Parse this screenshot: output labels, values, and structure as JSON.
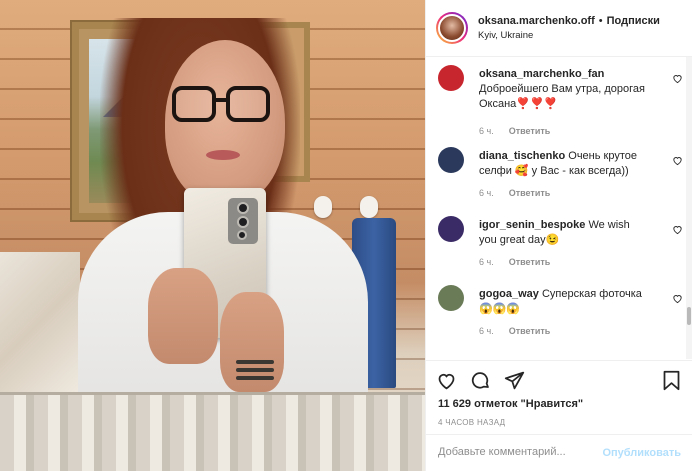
{
  "post": {
    "username": "oksana.marchenko.off",
    "separator": "•",
    "follow_label": "Подписки",
    "location": "Kyiv, Ukraine"
  },
  "comments": [
    {
      "username": "oksana_marchenko_fan",
      "text": "Доброейшего Вам утра, дорогая Оксана❣️❣️❣️",
      "time": "6 ч.",
      "reply_label": "Ответить",
      "avatar_color": "#c8262e"
    },
    {
      "username": "diana_tischenko",
      "text": "Очень крутое селфи 🥰 у Вас - как всегда))",
      "time": "6 ч.",
      "reply_label": "Ответить",
      "avatar_color": "#2b3a5c"
    },
    {
      "username": "igor_senin_bespoke",
      "text": "We wish you great day😉",
      "time": "6 ч.",
      "reply_label": "Ответить",
      "avatar_color": "#3a2a66"
    },
    {
      "username": "gogoa_way",
      "text": "Суперская фоточка 😱😱😱",
      "time": "6 ч.",
      "reply_label": "Ответить",
      "avatar_color": "#6a7b58"
    }
  ],
  "actions": {
    "likes": "11 629 отметок \"Нравится\"",
    "time_ago": "4 ЧАСОВ НАЗАД",
    "comment_placeholder": "Добавьте комментарий...",
    "publish_label": "Опубликовать"
  },
  "icons": [
    "heart-icon",
    "comment-icon",
    "share-icon",
    "bookmark-icon"
  ],
  "colors": {
    "avatar_ring": [
      "#f9ce34",
      "#ee2a7b",
      "#6228d7"
    ],
    "publish_disabled": "#b2dffc",
    "muted": "#8e8e8e"
  }
}
